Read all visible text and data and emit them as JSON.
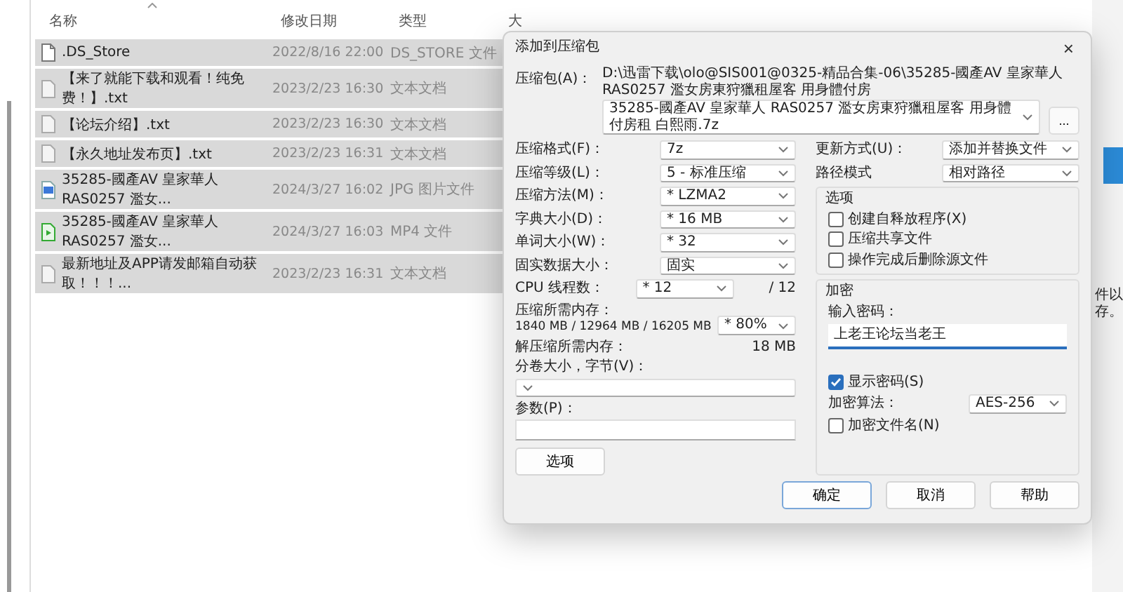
{
  "explorer": {
    "columns": [
      "名称",
      "修改日期",
      "类型",
      "大"
    ],
    "files": [
      {
        "name": ".DS_Store",
        "date": "2022/8/16 22:00",
        "type": "DS_STORE 文件",
        "kind": "file",
        "selected": true
      },
      {
        "name": "【来了就能下载和观看！纯免费！】.txt",
        "date": "2023/2/23 16:30",
        "type": "文本文档",
        "kind": "text",
        "selected": true
      },
      {
        "name": "【论坛介绍】.txt",
        "date": "2023/2/23 16:30",
        "type": "文本文档",
        "kind": "text",
        "selected": true
      },
      {
        "name": "【永久地址发布页】.txt",
        "date": "2023/2/23 16:31",
        "type": "文本文档",
        "kind": "text",
        "selected": true
      },
      {
        "name": "35285-國產AV 皇家華人 RAS0257 濫女...",
        "date": "2024/3/27 16:02",
        "type": "JPG 图片文件",
        "kind": "image",
        "selected": true
      },
      {
        "name": "35285-國產AV 皇家華人 RAS0257 濫女...",
        "date": "2024/3/27 16:03",
        "type": "MP4 文件",
        "kind": "video",
        "selected": true
      },
      {
        "name": "最新地址及APP请发邮箱自动获取！！！...",
        "date": "2023/2/23 16:31",
        "type": "文本文档",
        "kind": "text",
        "selected": true
      }
    ]
  },
  "side_text": [
    "件以",
    "存。"
  ],
  "dialog": {
    "title": "添加到压缩包",
    "close": "×",
    "archive": {
      "label": "压缩包(A)：",
      "path": "D:\\迅雷下载\\olo@SIS001@0325-精品合集-06\\35285-國產AV 皇家華人 RAS0257 濫女房東狩獵租屋客 用身體付房",
      "value": "35285-國產AV 皇家華人 RAS0257 濫女房東狩獵租屋客 用身體付房租 白熙雨.7z",
      "browse": "..."
    },
    "left": [
      {
        "kind": "dropdown",
        "label": "压缩格式(F)：",
        "value": "7z"
      },
      {
        "kind": "dropdown",
        "label": "压缩等级(L)：",
        "value": "5 - 标准压缩"
      },
      {
        "kind": "dropdown",
        "label": "压缩方法(M)：",
        "value": "* LZMA2"
      },
      {
        "kind": "dropdown",
        "label": "字典大小(D)：",
        "value": "* 16 MB"
      },
      {
        "kind": "dropdown",
        "label": "单词大小(W)：",
        "value": "* 32"
      },
      {
        "kind": "dropdown",
        "label": "固实数据大小：",
        "value": "固实"
      },
      {
        "kind": "dropdown_note",
        "label": "CPU 线程数：",
        "value": "* 12",
        "note": "/ 12"
      },
      {
        "kind": "memory",
        "label": "压缩所需内存：",
        "detail": "1840 MB / 12964 MB / 16205 MB",
        "value": "* 80%"
      },
      {
        "kind": "reading",
        "label": "解压缩所需内存：",
        "value": "18 MB"
      },
      {
        "kind": "wide_dropdown",
        "label": "分卷大小，字节(V)："
      },
      {
        "kind": "wide_field",
        "label": "参数(P)："
      }
    ],
    "options_button": "选项",
    "right": [
      {
        "label": "更新方式(U)：",
        "value": "添加并替换文件"
      },
      {
        "label": "路径模式",
        "value": "相对路径"
      }
    ],
    "options_group": {
      "title": "选项",
      "items": [
        {
          "label": "创建自释放程序(X)",
          "checked": false
        },
        {
          "label": "压缩共享文件",
          "checked": false
        },
        {
          "label": "操作完成后删除源文件",
          "checked": false
        }
      ]
    },
    "encryption": {
      "title": "加密",
      "password_label": "输入密码：",
      "password": "上老王论坛当老王",
      "show_password": {
        "label": "显示密码(S)",
        "checked": true
      },
      "algorithm": {
        "label": "加密算法：",
        "value": "AES-256"
      },
      "encrypt_names": {
        "label": "加密文件名(N)",
        "checked": false
      }
    },
    "buttons": [
      {
        "label": "确定",
        "default": true
      },
      {
        "label": "取消",
        "default": false
      },
      {
        "label": "帮助",
        "default": false
      }
    ]
  }
}
